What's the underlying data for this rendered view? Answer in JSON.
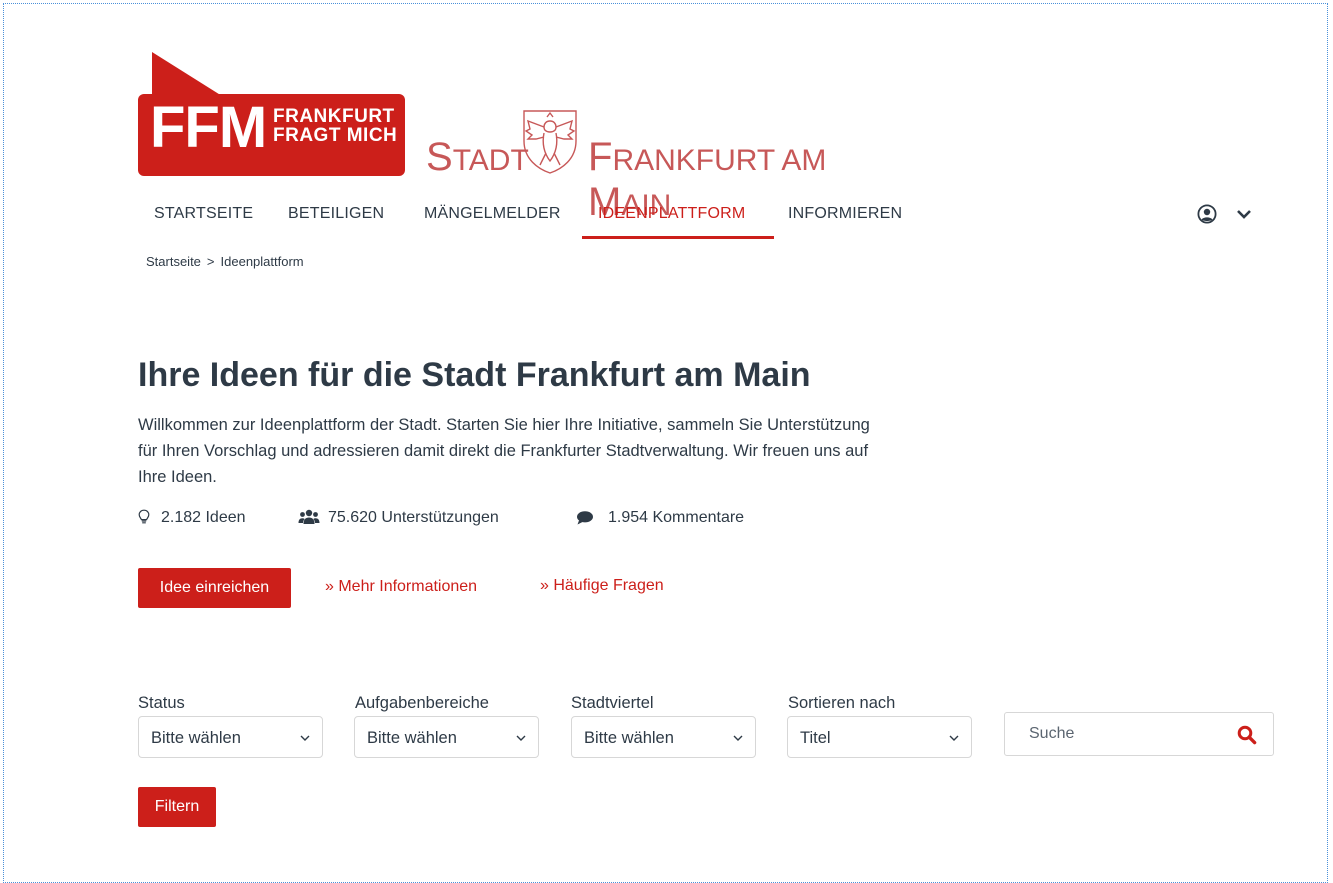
{
  "brand": {
    "ffm_big": "FFM",
    "ffm_line1": "FRANKFURT",
    "ffm_line2": "FRAGT MICH",
    "stadt_word1": "Stadt",
    "stadt_word2": "Frankfurt am Main",
    "red": "#cc1f1a",
    "stadt_color": "#c75858"
  },
  "nav": {
    "items": [
      {
        "label": "STARTSEITE"
      },
      {
        "label": "BETEILIGEN"
      },
      {
        "label": "MÄNGELMELDER"
      },
      {
        "label": "IDEENPLATTFORM",
        "active": true
      },
      {
        "label": "INFORMIEREN"
      }
    ],
    "user_icon": "user-circle-icon",
    "menu_icon": "chevron-down-icon"
  },
  "breadcrumb": {
    "items": [
      "Startseite",
      "Ideenplattform"
    ],
    "separator": ">"
  },
  "page": {
    "title": "Ihre Ideen für die Stadt Frankfurt am Main",
    "intro": "Willkommen zur Ideenplattform der Stadt. Starten Sie hier Ihre Initiative, sammeln Sie Unterstützung für Ihren Vorschlag und adressieren damit direkt die Frankfurter Stadtverwaltung. Wir freuen uns auf Ihre Ideen."
  },
  "stats": {
    "ideas": "2.182 Ideen",
    "supports": "75.620 Unterstützungen",
    "comments": "1.954 Kommentare",
    "icons": [
      "lightbulb-icon",
      "users-icon",
      "comment-icon"
    ]
  },
  "actions": {
    "submit_label": "Idee einreichen",
    "more_info": "» Mehr Informationen",
    "faq": "» Häufige Fragen"
  },
  "filters": {
    "status": {
      "label": "Status",
      "value": "Bitte wählen"
    },
    "areas": {
      "label": "Aufgabenbereiche",
      "value": "Bitte wählen"
    },
    "district": {
      "label": "Stadtviertel",
      "value": "Bitte wählen"
    },
    "sort": {
      "label": "Sortieren nach",
      "value": "Titel"
    },
    "search_placeholder": "Suche",
    "filter_button": "Filtern"
  }
}
